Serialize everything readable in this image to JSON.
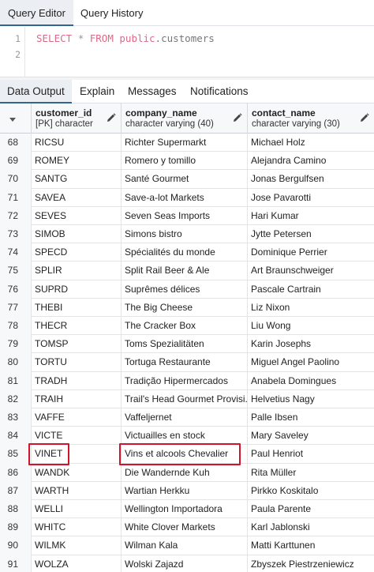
{
  "top_tabs": [
    "Query Editor",
    "Query History"
  ],
  "editor": {
    "line_numbers": [
      "1",
      "2"
    ],
    "query": {
      "select": "SELECT",
      "star": "*",
      "from": "FROM",
      "schema": "public",
      "dot": ".",
      "table": "customers"
    }
  },
  "result_tabs": [
    "Data Output",
    "Explain",
    "Messages",
    "Notifications"
  ],
  "columns": [
    {
      "name": "customer_id",
      "type": "[PK] character"
    },
    {
      "name": "company_name",
      "type": "character varying (40)"
    },
    {
      "name": "contact_name",
      "type": "character varying (30)"
    }
  ],
  "rows": [
    {
      "n": "68",
      "id": "RICSU",
      "company": "Richter Supermarkt",
      "contact": "Michael Holz"
    },
    {
      "n": "69",
      "id": "ROMEY",
      "company": "Romero y tomillo",
      "contact": "Alejandra Camino"
    },
    {
      "n": "70",
      "id": "SANTG",
      "company": "Santé Gourmet",
      "contact": "Jonas Bergulfsen"
    },
    {
      "n": "71",
      "id": "SAVEA",
      "company": "Save-a-lot Markets",
      "contact": "Jose Pavarotti"
    },
    {
      "n": "72",
      "id": "SEVES",
      "company": "Seven Seas Imports",
      "contact": "Hari Kumar"
    },
    {
      "n": "73",
      "id": "SIMOB",
      "company": "Simons bistro",
      "contact": "Jytte Petersen"
    },
    {
      "n": "74",
      "id": "SPECD",
      "company": "Spécialités du monde",
      "contact": "Dominique Perrier"
    },
    {
      "n": "75",
      "id": "SPLIR",
      "company": "Split Rail Beer & Ale",
      "contact": "Art Braunschweiger"
    },
    {
      "n": "76",
      "id": "SUPRD",
      "company": "Suprêmes délices",
      "contact": "Pascale Cartrain"
    },
    {
      "n": "77",
      "id": "THEBI",
      "company": "The Big Cheese",
      "contact": "Liz Nixon"
    },
    {
      "n": "78",
      "id": "THECR",
      "company": "The Cracker Box",
      "contact": "Liu Wong"
    },
    {
      "n": "79",
      "id": "TOMSP",
      "company": "Toms Spezialitäten",
      "contact": "Karin Josephs"
    },
    {
      "n": "80",
      "id": "TORTU",
      "company": "Tortuga Restaurante",
      "contact": "Miguel Angel Paolino"
    },
    {
      "n": "81",
      "id": "TRADH",
      "company": "Tradição Hipermercados",
      "contact": "Anabela Domingues"
    },
    {
      "n": "82",
      "id": "TRAIH",
      "company": "Trail's Head Gourmet Provisi...",
      "contact": "Helvetius Nagy"
    },
    {
      "n": "83",
      "id": "VAFFE",
      "company": "Vaffeljernet",
      "contact": "Palle Ibsen"
    },
    {
      "n": "84",
      "id": "VICTE",
      "company": "Victuailles en stock",
      "contact": "Mary Saveley"
    },
    {
      "n": "85",
      "id": "VINET",
      "company": "Vins et alcools Chevalier",
      "contact": "Paul Henriot"
    },
    {
      "n": "86",
      "id": "WANDK",
      "company": "Die Wandernde Kuh",
      "contact": "Rita Müller"
    },
    {
      "n": "87",
      "id": "WARTH",
      "company": "Wartian Herkku",
      "contact": "Pirkko Koskitalo"
    },
    {
      "n": "88",
      "id": "WELLI",
      "company": "Wellington Importadora",
      "contact": "Paula Parente"
    },
    {
      "n": "89",
      "id": "WHITC",
      "company": "White Clover Markets",
      "contact": "Karl Jablonski"
    },
    {
      "n": "90",
      "id": "WILMK",
      "company": "Wilman Kala",
      "contact": "Matti Karttunen"
    },
    {
      "n": "91",
      "id": "WOLZA",
      "company": "Wolski  Zajazd",
      "contact": "Zbyszek Piestrzeniewicz"
    }
  ],
  "highlighted_row": 17,
  "colors": {
    "accent": "#326690",
    "highlight": "#d0142c",
    "keyword": "#d96b8a"
  }
}
